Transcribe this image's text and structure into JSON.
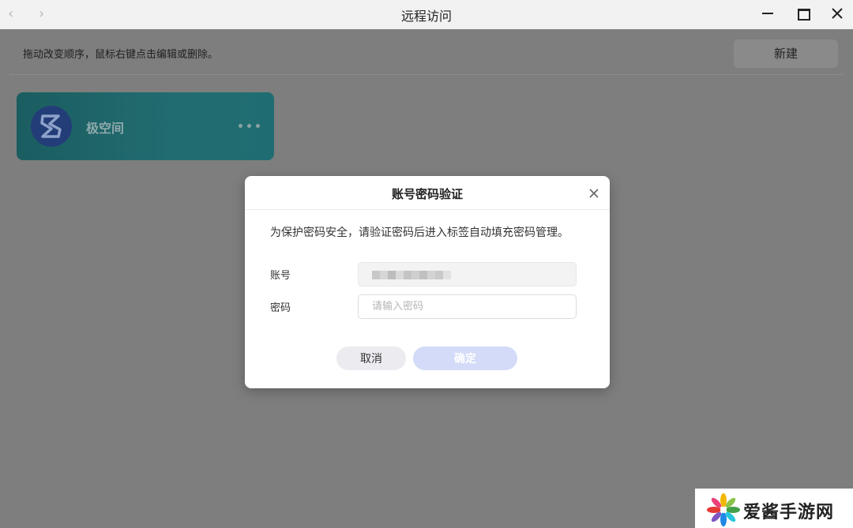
{
  "window": {
    "title": "远程访问",
    "back_icon": "‹",
    "forward_icon": "›"
  },
  "toolbar": {
    "hint": "拖动改变顺序，鼠标右键点击编辑或删除。",
    "new_button": "新建"
  },
  "cards": [
    {
      "label": "极空间",
      "icon": "zspace-logo-icon"
    }
  ],
  "dialog": {
    "title": "账号密码验证",
    "message": "为保护密码安全，请验证密码后进入标签自动填充密码管理。",
    "account_label": "账号",
    "password_label": "密码",
    "password_placeholder": "请输入密码",
    "cancel_label": "取消",
    "confirm_label": "确定"
  },
  "watermark": {
    "text": "爱酱手游网"
  },
  "colors": {
    "card_bg": "#216c70",
    "confirm_disabled": "#d4dbf8",
    "overlay": "#7f7f7f"
  }
}
